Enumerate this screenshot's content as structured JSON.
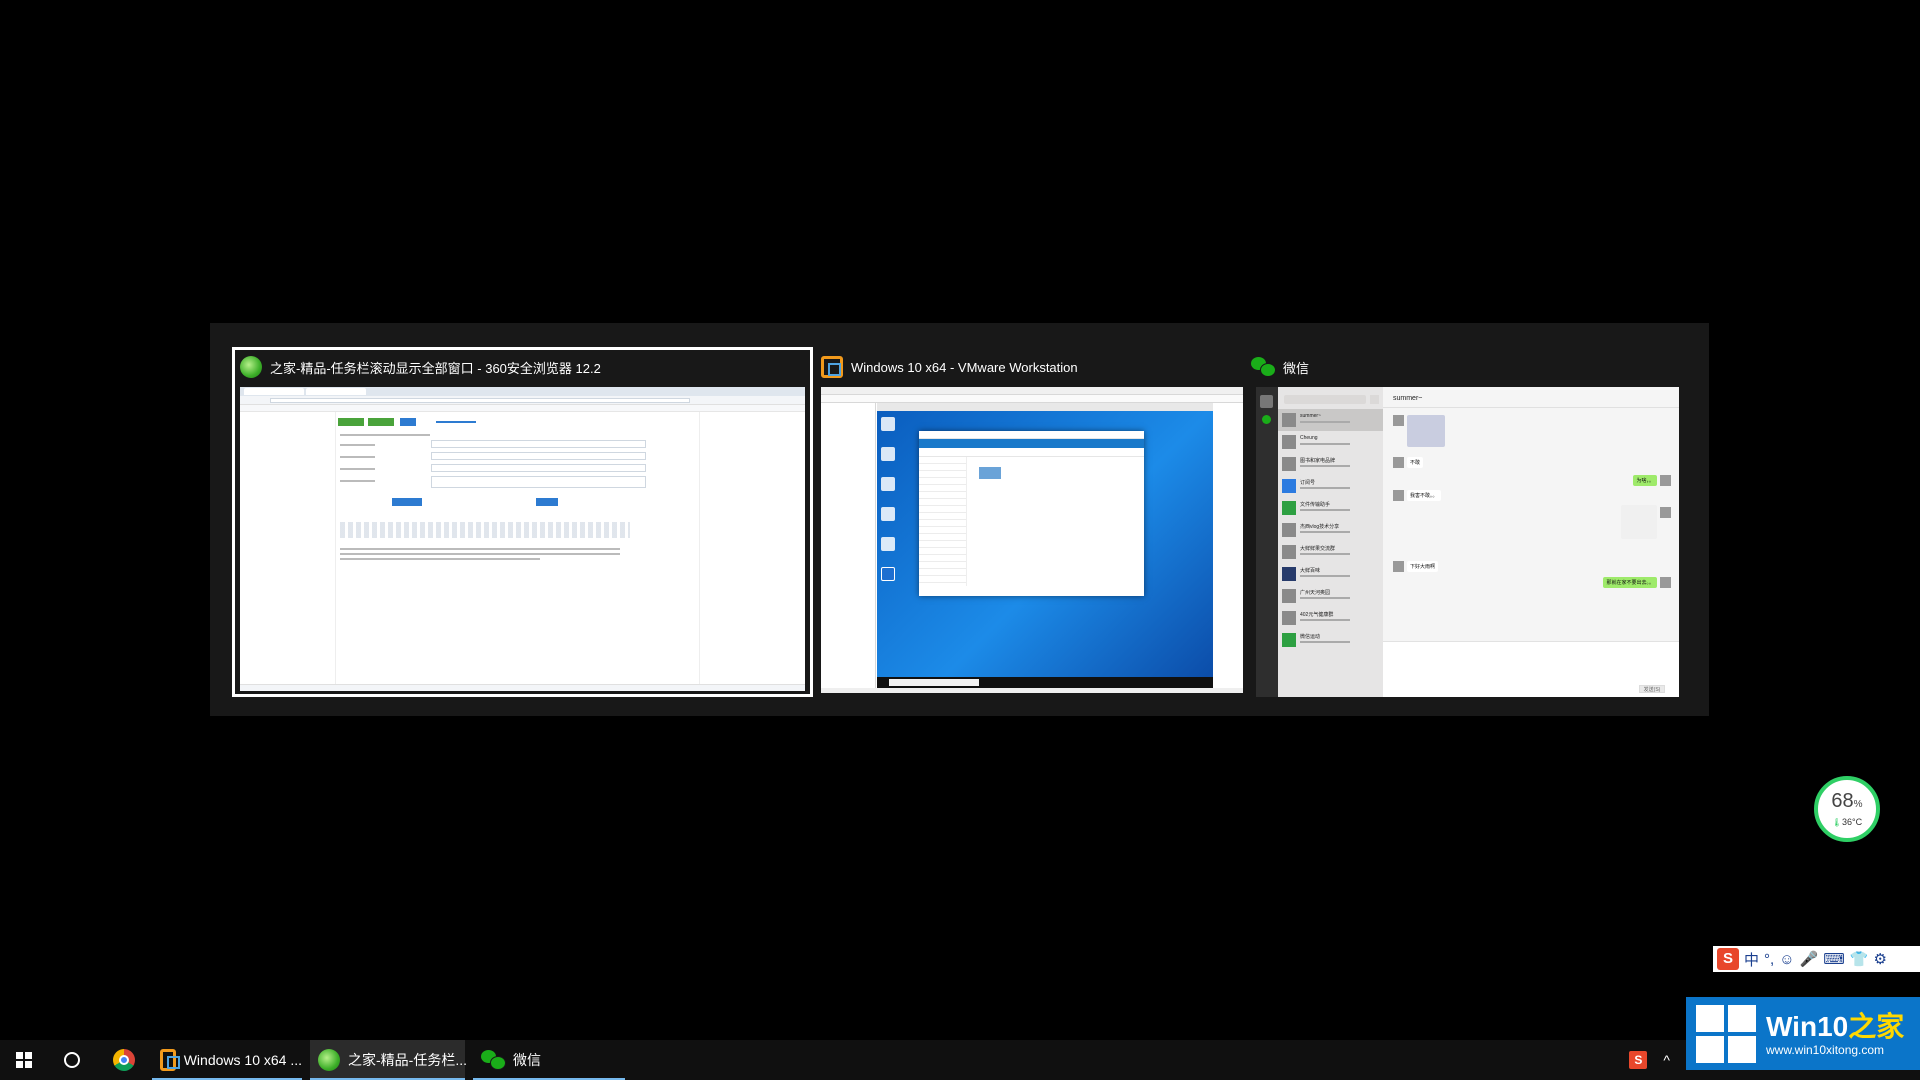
{
  "switcher": {
    "items": [
      {
        "title": "之家-精品-任务栏滚动显示全部窗口 - 360安全浏览器 12.2",
        "icon": "360-browser-icon",
        "selected": true
      },
      {
        "title": "Windows 10 x64 - VMware Workstation",
        "icon": "vmware-icon",
        "selected": false
      },
      {
        "title": "微信",
        "icon": "wechat-icon",
        "selected": false
      }
    ]
  },
  "wechat_preview": {
    "chat_title": "summer~",
    "contacts": [
      "summer~",
      "Cheung",
      "图书和家电品牌",
      "订阅号",
      "文件传输助手",
      "杰西vlog技术分享",
      "大鲜鲜果交流群",
      "大鲜百味",
      "广州天河奥园",
      "402元气健康群",
      "微信运动"
    ],
    "messages": [
      {
        "dir": "in",
        "text": "不敢"
      },
      {
        "dir": "out",
        "text": "为啥，。"
      },
      {
        "dir": "in",
        "text": "我害不敢。。"
      },
      {
        "dir": "in",
        "text": "下好大雨啊"
      },
      {
        "dir": "out",
        "text": "那就在家不要出去。。"
      }
    ],
    "send_label": "发送(S)"
  },
  "monitor": {
    "percent": "68",
    "percent_unit": "%",
    "temp": "36°C",
    "accent": "#2fcf65"
  },
  "ime": {
    "logo": "S",
    "items": [
      "中",
      "°,",
      "☺",
      "🎤",
      "⌨",
      "👕",
      "⚙"
    ]
  },
  "watermark": {
    "title_prefix": "Win10",
    "title_suffix": "之家",
    "url": "www.win10xitong.com"
  },
  "taskbar": {
    "apps": [
      {
        "label": "Windows 10 x64 ...",
        "icon": "vmware-icon"
      },
      {
        "label": "之家-精品-任务栏...",
        "icon": "360-browser-icon"
      },
      {
        "label": "微信",
        "icon": "wechat-icon"
      }
    ],
    "tray_up": "^",
    "tray_s": "S"
  },
  "colors": {
    "background": "#000000",
    "switcher_bg": "#181818",
    "taskbar": "#101010",
    "accent_underline": "#76b9ed"
  }
}
